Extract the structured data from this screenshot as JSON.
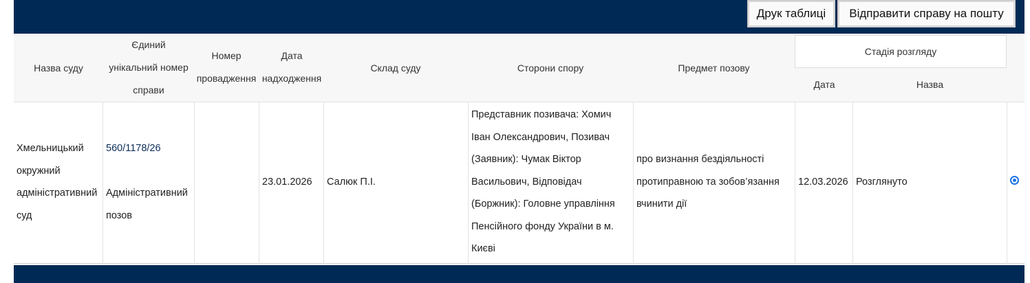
{
  "toolbar": {
    "print_label": "Друк таблиці",
    "email_label": "Відправити справу на пошту"
  },
  "table": {
    "headers": {
      "court_name": "Назва суду",
      "case_number_line1": "Єдиний",
      "case_number_line2": "унікальний номер",
      "case_number_line3": "справи",
      "proceeding_line1": "Номер",
      "proceeding_line2": "провадження",
      "received_line1": "Дата",
      "received_line2": "надходження",
      "composition": "Склад суду",
      "parties": "Сторони спору",
      "subject": "Предмет позову",
      "stage": "Стадія розгляду",
      "stage_date": "Дата",
      "stage_name": "Назва"
    },
    "row": {
      "court_lines": [
        "Хмельницький",
        "окружний",
        "адміністративний",
        "суд"
      ],
      "case_number": "560/1178/26",
      "case_type_lines": [
        "Адміністративний",
        "позов"
      ],
      "proceeding_number": "",
      "received_date": "23.01.2026",
      "composition": "Салюк П.І.",
      "parties_lines": [
        "Представник позивача: Хомич",
        "Іван Олександрович, Позивач",
        "(Заявник): Чумак Віктор",
        "Васильович, Відповідач",
        "(Боржник): Головне управління",
        "Пенсійного фонду України в м.",
        "Києві"
      ],
      "subject_lines": [
        "про визнання бездіяльності",
        "протиправною та зобов’язання",
        "вчинити дії"
      ],
      "stage_date": "12.03.2026",
      "stage_name": "Розглянуто",
      "selected": true
    }
  },
  "colors": {
    "header_bar": "#002a55",
    "table_header_bg": "#f7f7f7",
    "radio_accent": "#1a73e8"
  }
}
